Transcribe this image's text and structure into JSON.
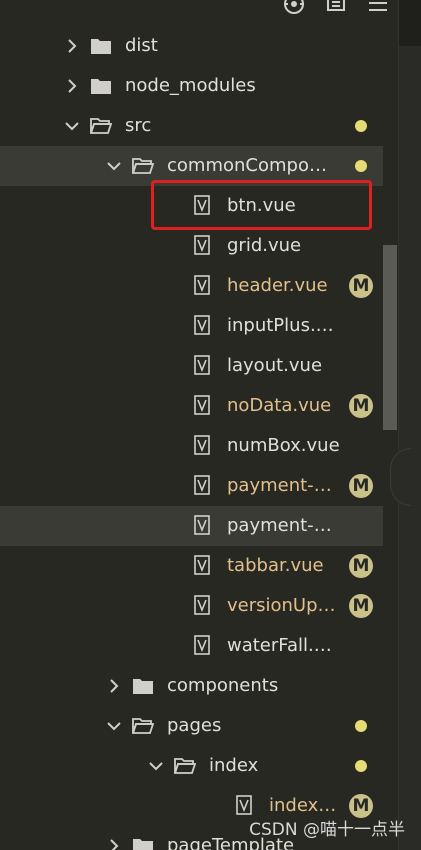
{
  "toolbar": {
    "icons": [
      "target-icon",
      "new-file-icon",
      "menu-icon"
    ]
  },
  "tree": {
    "items": [
      {
        "label": "dist",
        "kind": "folder",
        "expanded": false,
        "status": ""
      },
      {
        "label": "node_modules",
        "kind": "folder",
        "expanded": false,
        "status": ""
      },
      {
        "label": "src",
        "kind": "folder",
        "expanded": true,
        "status": "dot"
      },
      {
        "label": "commonCompone...",
        "kind": "folder",
        "expanded": true,
        "status": "dot"
      },
      {
        "label": "btn.vue",
        "kind": "file",
        "status": "",
        "highlighted": true
      },
      {
        "label": "grid.vue",
        "kind": "file",
        "status": ""
      },
      {
        "label": "header.vue",
        "kind": "file",
        "status": "M"
      },
      {
        "label": "inputPlus.vue",
        "kind": "file",
        "status": ""
      },
      {
        "label": "layout.vue",
        "kind": "file",
        "status": ""
      },
      {
        "label": "noData.vue",
        "kind": "file",
        "status": "M"
      },
      {
        "label": "numBox.vue",
        "kind": "file",
        "status": ""
      },
      {
        "label": "payment-pas...",
        "kind": "file",
        "status": "M"
      },
      {
        "label": "payment-passw...",
        "kind": "file",
        "status": "",
        "selected": true
      },
      {
        "label": "tabbar.vue",
        "kind": "file",
        "status": "M"
      },
      {
        "label": "versionUpdat...",
        "kind": "file",
        "status": "M"
      },
      {
        "label": "waterFall.vue",
        "kind": "file",
        "status": ""
      },
      {
        "label": "components",
        "kind": "folder",
        "expanded": false,
        "status": ""
      },
      {
        "label": "pages",
        "kind": "folder",
        "expanded": true,
        "status": "dot"
      },
      {
        "label": "index",
        "kind": "folder",
        "expanded": true,
        "status": "dot"
      },
      {
        "label": "index.vue",
        "kind": "file",
        "status": "M"
      },
      {
        "label": "pageTemplate",
        "kind": "folder",
        "expanded": false,
        "status": ""
      }
    ]
  },
  "badges": {
    "modified": "M"
  },
  "watermark": {
    "text": "CSDN @喵十一点半"
  },
  "colors": {
    "background": "#272822",
    "modified_text": "#e2c08d",
    "dot": "#e6db74",
    "highlight_border": "#e02020",
    "selected_row": "#3a3b35"
  }
}
